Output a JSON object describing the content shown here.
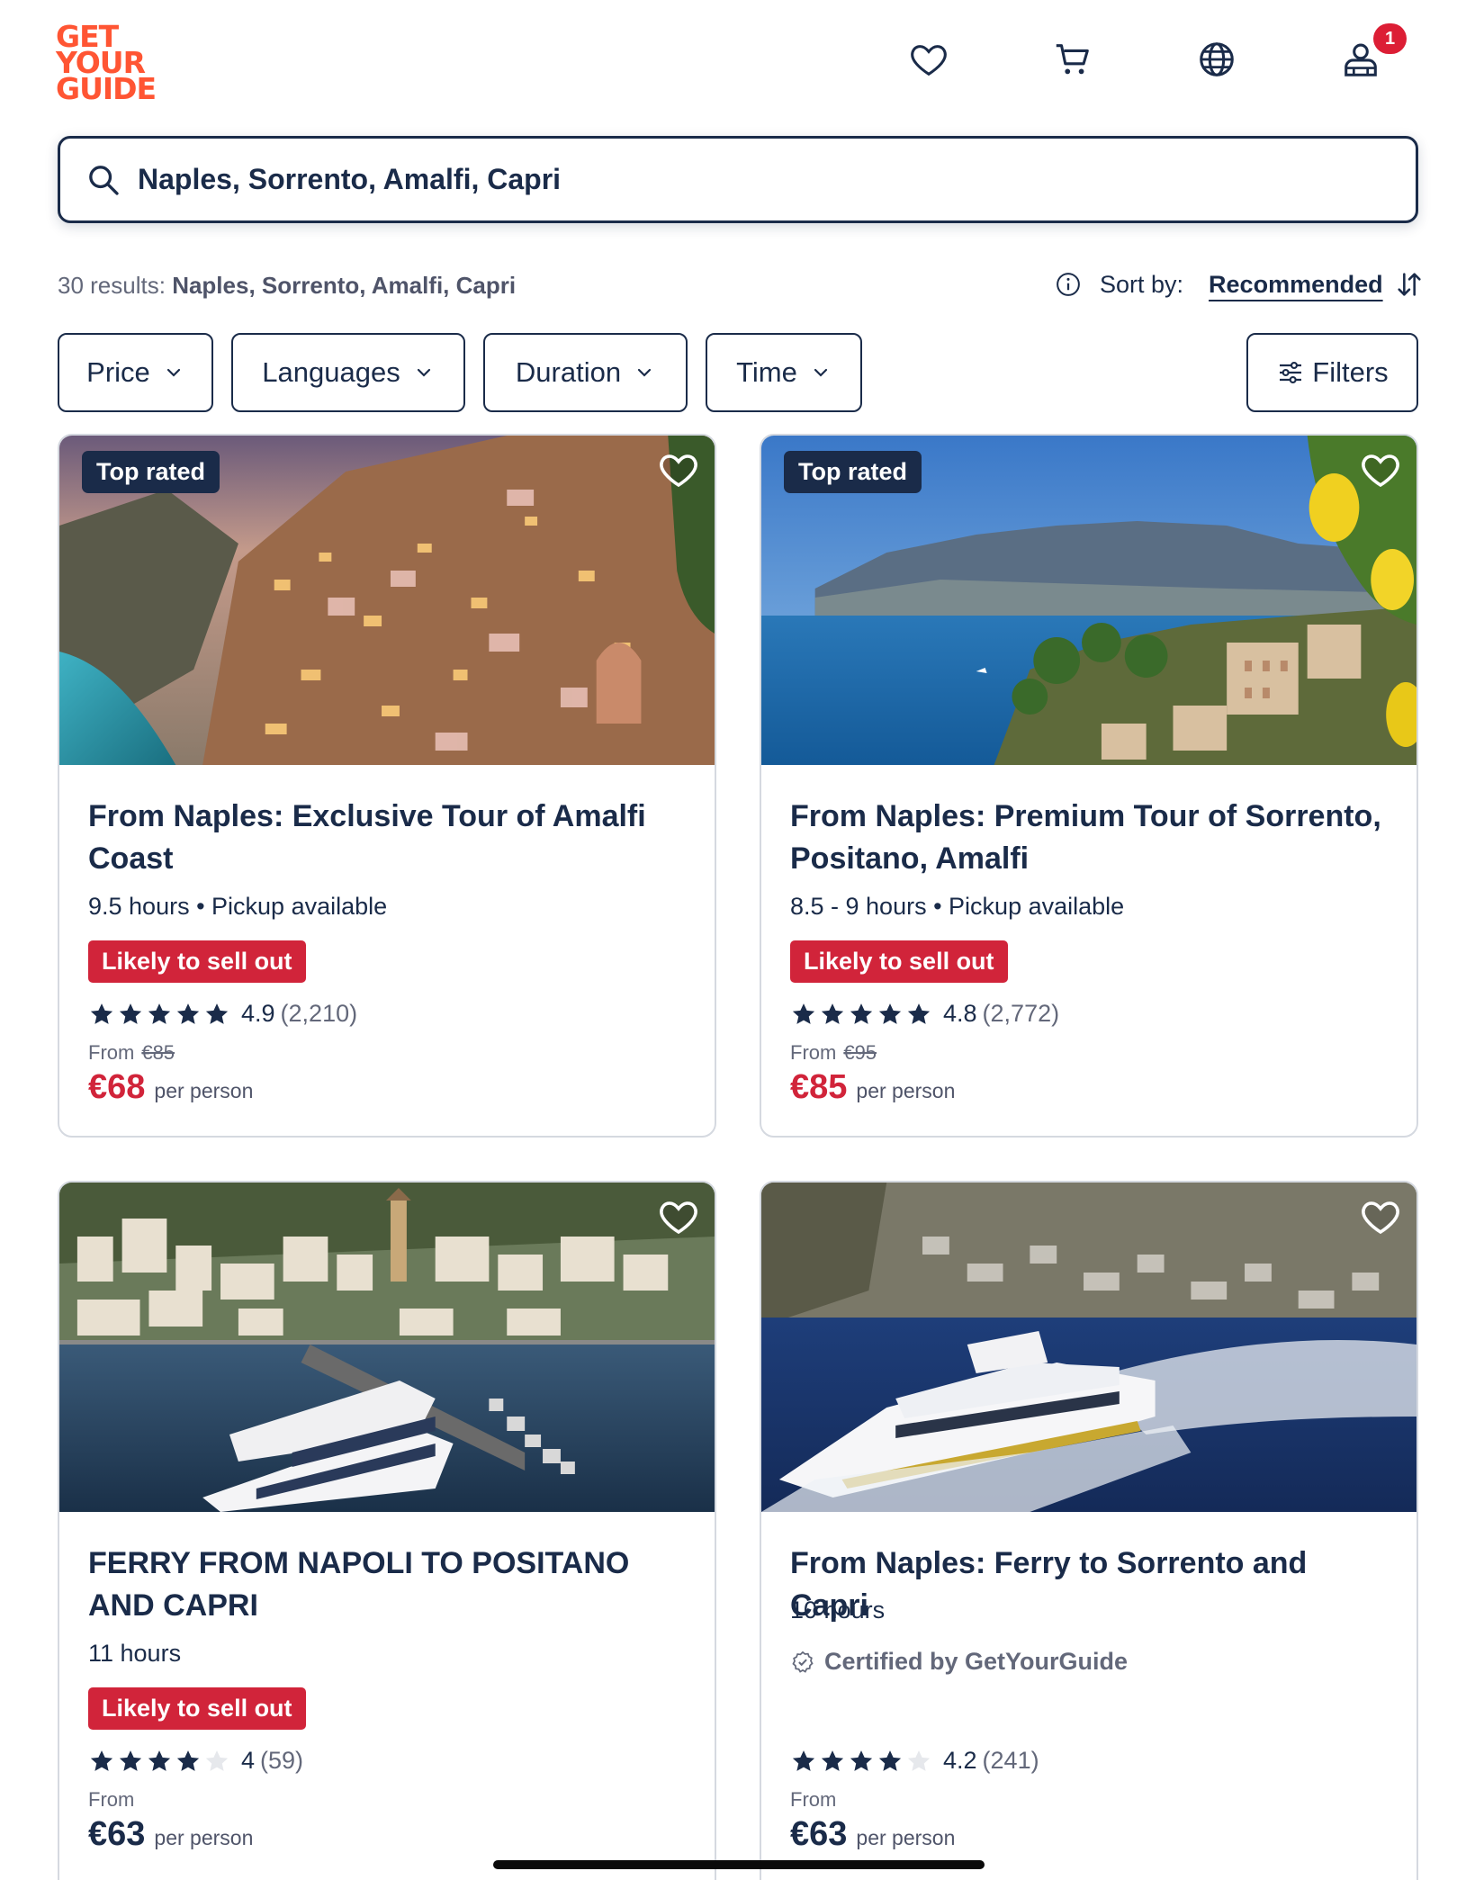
{
  "header": {
    "logo_lines": [
      "GET",
      "YOUR",
      "GUIDE"
    ],
    "icons": [
      "heart-icon",
      "cart-icon",
      "globe-icon",
      "profile-icon"
    ],
    "notification_count": "1"
  },
  "search": {
    "value": "Naples, Sorrento, Amalfi, Capri"
  },
  "results": {
    "count_text": "30 results:",
    "query_text": "Naples, Sorrento, Amalfi, Capri"
  },
  "sort": {
    "label": "Sort by:",
    "value": "Recommended"
  },
  "filters": {
    "price": "Price",
    "languages": "Languages",
    "duration": "Duration",
    "time": "Time",
    "all": "Filters"
  },
  "cards": [
    {
      "tag": "Top rated",
      "title": "From Naples: Exclusive Tour of Amalfi Coast",
      "meta": "9.5 hours • Pickup available",
      "badge": "Likely to sell out",
      "stars": 5,
      "rating": "4.9",
      "reviews": "(2,210)",
      "from": "From",
      "old_price": "€85",
      "price": "€68",
      "per_person": "per person",
      "price_color": "#d1243a"
    },
    {
      "tag": "Top rated",
      "title": "From Naples: Premium Tour of Sorrento, Positano, Amalfi",
      "meta": "8.5 - 9 hours • Pickup available",
      "badge": "Likely to sell out",
      "stars": 5,
      "rating": "4.8",
      "reviews": "(2,772)",
      "from": "From",
      "old_price": "€95",
      "price": "€85",
      "per_person": "per person",
      "price_color": "#d1243a"
    },
    {
      "title": "FERRY FROM NAPOLI TO POSITANO AND CAPRI",
      "meta": "11 hours",
      "badge": "Likely to sell out",
      "stars": 4,
      "rating": "4",
      "reviews": "(59)",
      "from": "From",
      "price": "€63",
      "per_person": "per person",
      "price_color": "#1a2b49"
    },
    {
      "title": "From Naples: Ferry to Sorrento and Capri",
      "meta": "10 hours",
      "certified": "Certified by GetYourGuide",
      "stars": 4,
      "rating": "4.2",
      "reviews": "(241)",
      "from": "From",
      "price": "€63",
      "per_person": "per person",
      "price_color": "#1a2b49"
    }
  ],
  "colors": {
    "brand": "#ff5533",
    "navy": "#1a2b49",
    "sale_red": "#d1243a"
  }
}
